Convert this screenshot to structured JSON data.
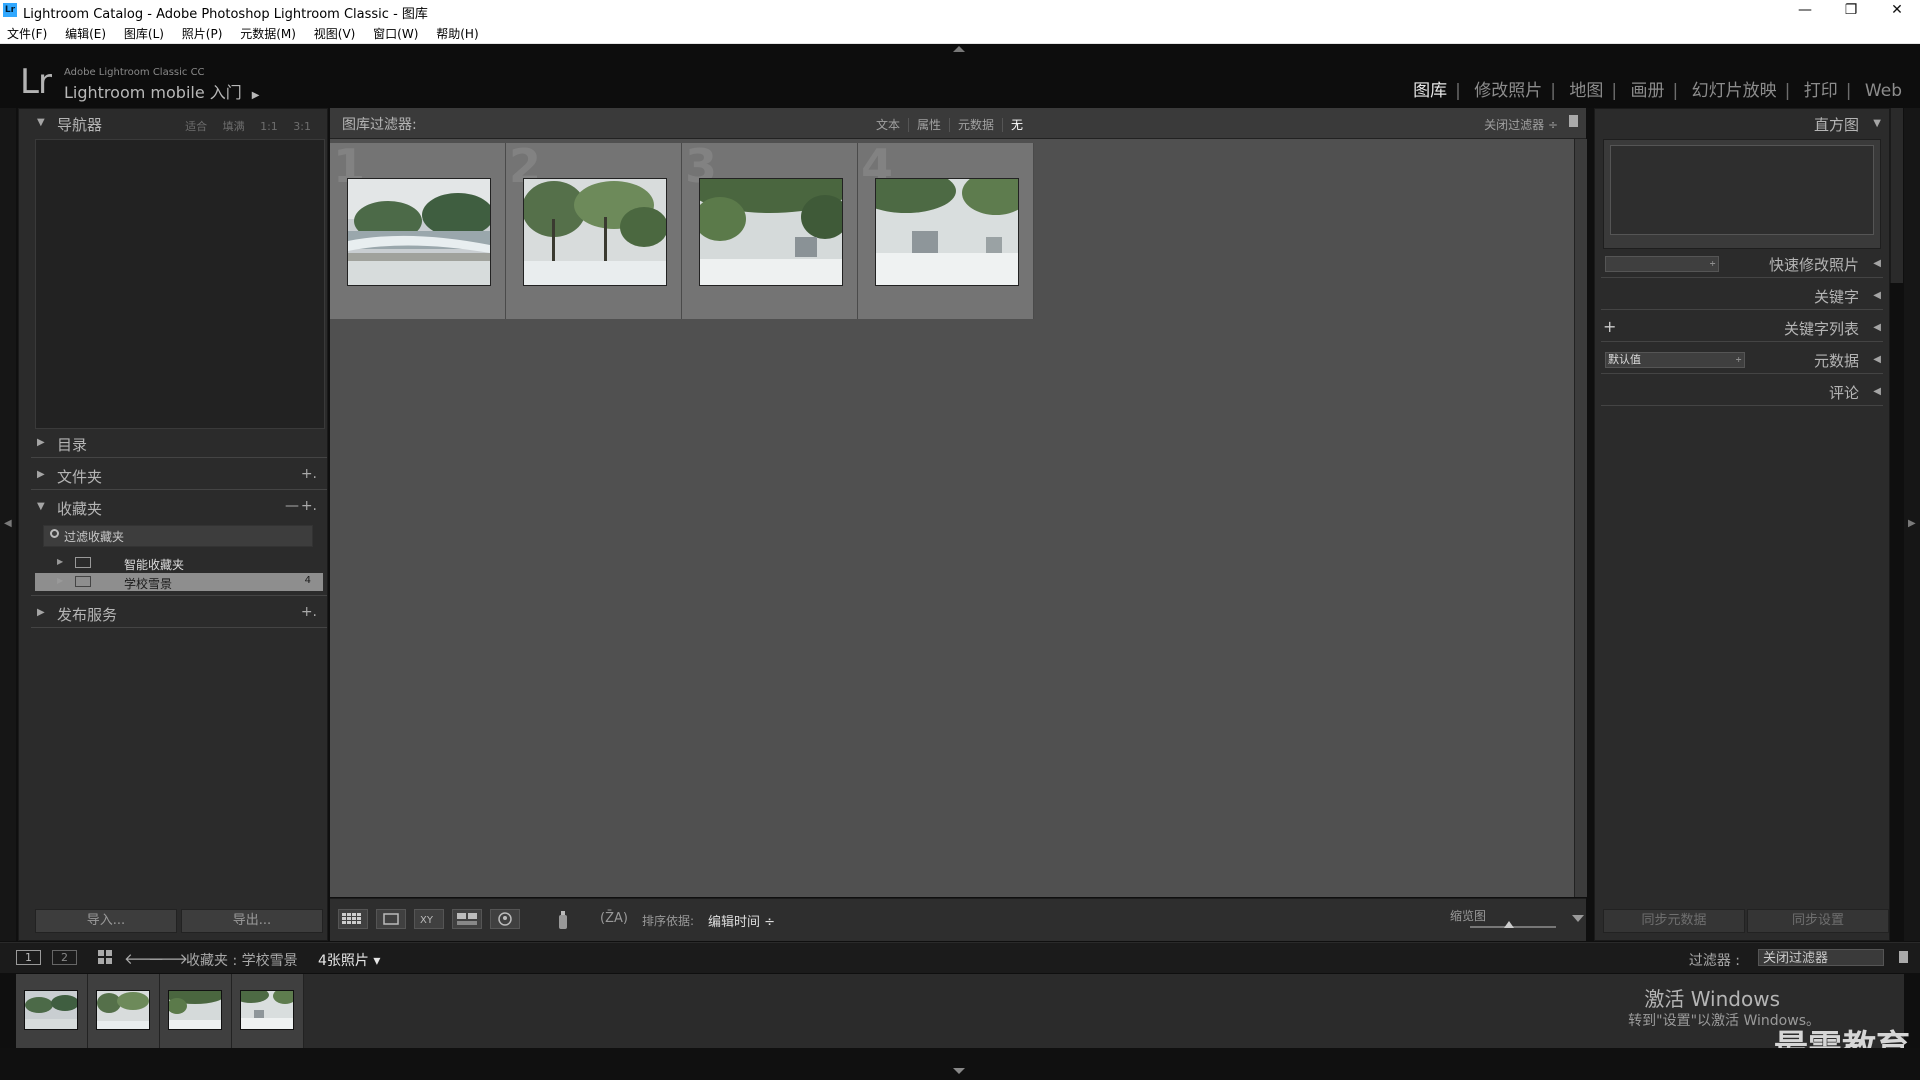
{
  "window": {
    "icon_text": "Lr",
    "title": "Lightroom Catalog - Adobe Photoshop Lightroom Classic - 图库",
    "minimize": "—",
    "restore": "❐",
    "close": "✕"
  },
  "menu": [
    "文件(F)",
    "编辑(E)",
    "图库(L)",
    "照片(P)",
    "元数据(M)",
    "视图(V)",
    "窗口(W)",
    "帮助(H)"
  ],
  "identity": {
    "logo": "Lr",
    "product": "Adobe Lightroom Classic CC",
    "subtitle": "Lightroom mobile 入门",
    "subtitle_arrow": "▶"
  },
  "modules": {
    "items": [
      "图库",
      "修改照片",
      "地图",
      "画册",
      "幻灯片放映",
      "打印",
      "Web"
    ],
    "active": "图库"
  },
  "left_panel": {
    "navigator": {
      "label": "导航器",
      "zoom": [
        "适合",
        "填满",
        "1:1",
        "3:1"
      ]
    },
    "catalog": {
      "label": "目录"
    },
    "folders": {
      "label": "文件夹",
      "add": "+."
    },
    "collections": {
      "label": "收藏夹",
      "minus": "—",
      "add": "+.",
      "search": "过滤收藏夹",
      "items": [
        {
          "label": "智能收藏夹",
          "count": ""
        },
        {
          "label": "学校雪景",
          "count": "4"
        }
      ]
    },
    "publish": {
      "label": "发布服务",
      "add": "+."
    },
    "import_label": "导入...",
    "export_label": "导出..."
  },
  "filter_bar": {
    "label": "图库过滤器:",
    "options": [
      "文本",
      "属性",
      "元数据",
      "无"
    ],
    "active": "无",
    "close_label": "关闭过滤器 ÷"
  },
  "grid": {
    "cells": [
      {
        "number": "1",
        "scene": "bridge"
      },
      {
        "number": "2",
        "scene": "trees"
      },
      {
        "number": "3",
        "scene": "canopy"
      },
      {
        "number": "4",
        "scene": "field"
      }
    ]
  },
  "toolbar": {
    "sort_label": "排序依据:",
    "sort_value": "编辑时间 ÷",
    "az_label": "(Z̄A)",
    "zoom_label": "缩览图",
    "zoom_level": 0.45
  },
  "right_panel": {
    "histogram": {
      "label": "直方图"
    },
    "quick_develop": {
      "label": "快速修改照片"
    },
    "keywording": {
      "label": "关键字"
    },
    "keyword_list": {
      "label": "关键字列表",
      "add": "+"
    },
    "metadata": {
      "label": "元数据",
      "preset": "默认值"
    },
    "comments": {
      "label": "评论"
    },
    "sync_metadata": "同步元数据",
    "sync_settings": "同步设置"
  },
  "filmstrip_bar": {
    "screen1": "1",
    "screen2": "2",
    "source": "收藏夹 : 学校雪景",
    "count": "4张照片 ▾",
    "filter_label": "过滤器 :",
    "filter_value": "关闭过滤器"
  },
  "overlay": {
    "activate_title": "激活 Windows",
    "activate_sub": "转到\"设置\"以激活 Windows。",
    "watermark": "最需教育"
  },
  "colors": {
    "accent": "#31a8ff",
    "panel": "#2b2b2b",
    "grid_bg": "#505050",
    "cell_bg": "#747474",
    "selected_row": "#8e8e8e"
  }
}
